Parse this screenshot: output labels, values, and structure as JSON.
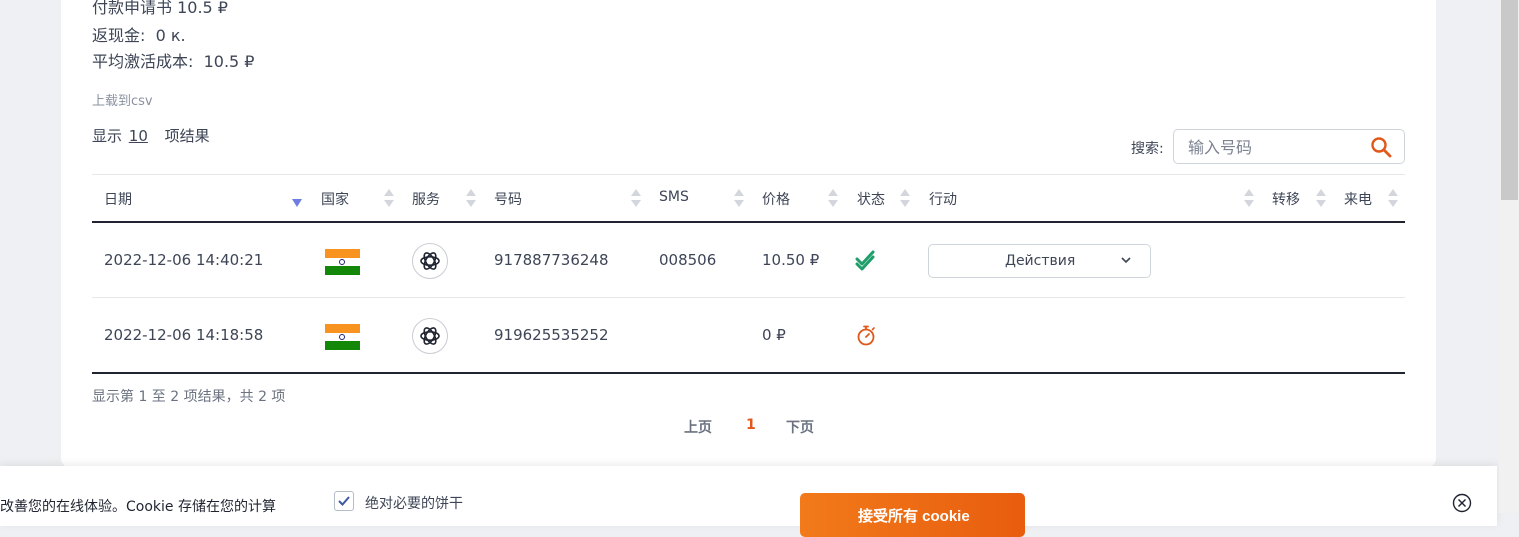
{
  "summary": {
    "partial_line": "付款申请书 10.5 ₽",
    "cashback_label": "返现金:",
    "cashback_value": "0 к.",
    "avg_cost_label": "平均激活成本:",
    "avg_cost_value": "10.5 ₽"
  },
  "csv_link": "上载到csv",
  "show": {
    "prefix": "显示",
    "count": "10",
    "suffix": "项结果"
  },
  "search": {
    "label": "搜索:",
    "placeholder": "输入号码"
  },
  "columns": {
    "date": "日期",
    "country": "国家",
    "service": "服务",
    "number": "号码",
    "sms": "SMS",
    "price": "价格",
    "status": "状态",
    "action": "行动",
    "transfer": "转移",
    "call": "来电"
  },
  "rows": [
    {
      "date": "2022-12-06 14:40:21",
      "country": "india-flag",
      "service": "openai-icon",
      "number": "917887736248",
      "sms": "008506",
      "price": "10.50 ₽",
      "status": "double-check-icon",
      "action_label": "Действия"
    },
    {
      "date": "2022-12-06 14:18:58",
      "country": "india-flag",
      "service": "openai-icon",
      "number": "919625535252",
      "sms": "",
      "price": "0 ₽",
      "status": "stopwatch-icon",
      "action_label": ""
    }
  ],
  "table_info": "显示第 1 至 2 项结果，共 2 项",
  "pagination": {
    "prev": "上页",
    "current": "1",
    "next": "下页"
  },
  "cookie": {
    "text": "改善您的在线体验。Cookie 存储在您的计算",
    "checkbox_label": "绝对必要的饼干",
    "accept_label": "接受所有 cookie"
  },
  "colors": {
    "accent": "#e0581a",
    "status_ok": "#1e9e6a",
    "sort_active": "#6e7ee0"
  }
}
